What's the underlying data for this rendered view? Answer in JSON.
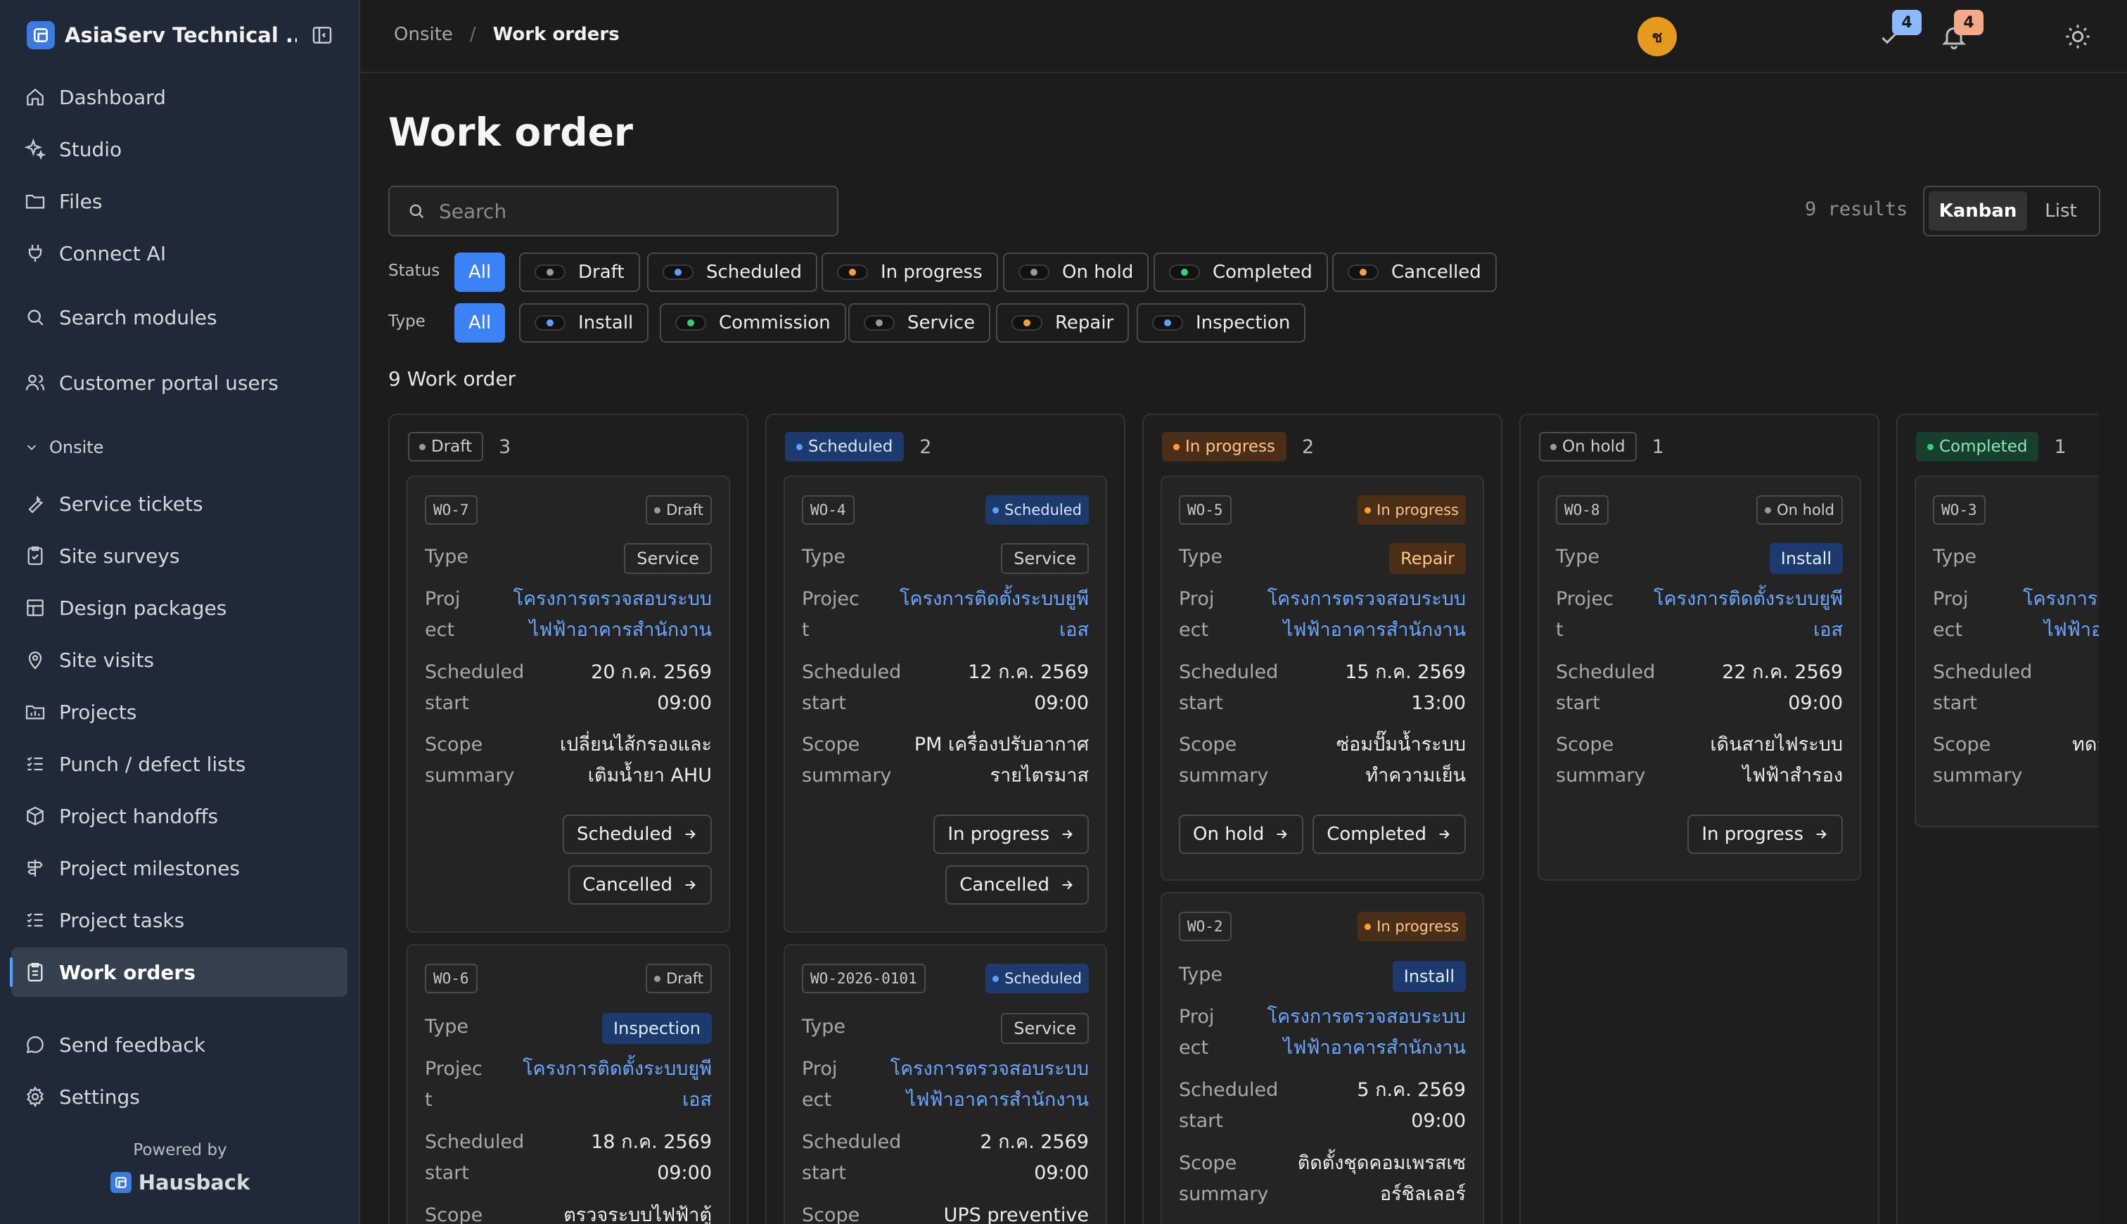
{
  "app": {
    "name": "AsiaServ Technical ...",
    "powered_by": "Powered by",
    "powered_brand": "Hausback"
  },
  "sidebar": {
    "items": [
      {
        "label": "Dashboard"
      },
      {
        "label": "Studio"
      },
      {
        "label": "Files"
      },
      {
        "label": "Connect AI"
      },
      {
        "label": "Search modules"
      },
      {
        "label": "Customer portal users"
      }
    ],
    "section": "Onsite",
    "onsite_items": [
      {
        "label": "Service tickets"
      },
      {
        "label": "Site surveys"
      },
      {
        "label": "Design packages"
      },
      {
        "label": "Site visits"
      },
      {
        "label": "Projects"
      },
      {
        "label": "Punch / defect lists"
      },
      {
        "label": "Project handoffs"
      },
      {
        "label": "Project milestones"
      },
      {
        "label": "Project tasks"
      },
      {
        "label": "Work orders"
      }
    ],
    "footer_items": [
      {
        "label": "Send feedback"
      },
      {
        "label": "Settings"
      }
    ]
  },
  "topbar": {
    "breadcrumb": [
      "Onsite",
      "Work orders"
    ],
    "tasks_badge": "4",
    "notifications_badge": "4",
    "avatar_initial": "ช"
  },
  "page": {
    "title": "Work order",
    "search_placeholder": "Search",
    "results": "9 results",
    "views": [
      "Kanban",
      "List"
    ],
    "count_line": "9 Work order"
  },
  "filters": {
    "status_label": "Status",
    "status": [
      "All",
      "Draft",
      "Scheduled",
      "In progress",
      "On hold",
      "Completed",
      "Cancelled"
    ],
    "type_label": "Type",
    "type": [
      "All",
      "Install",
      "Commission",
      "Service",
      "Repair",
      "Inspection"
    ]
  },
  "colors": {
    "accent": "#3b82f6",
    "draft": "#9a9a9a",
    "scheduled": "#5aa0ff",
    "in_progress": "#ff9d3b",
    "on_hold": "#9a9a9a",
    "completed": "#35d07f",
    "cancelled": "#ff9d3b"
  },
  "labels": {
    "type": "Type",
    "project_a": "Proj",
    "project_b": "ect",
    "project_c": "Projec",
    "project_d": "t",
    "sched_a": "Scheduled",
    "sched_b": "start",
    "scope_a": "Scope",
    "scope_b": "summary"
  },
  "columns": [
    {
      "status": "Draft",
      "count": "3",
      "cards": [
        {
          "id": "WO-7",
          "status": "Draft",
          "type": "Service",
          "project_1": "โครงการตรวจสอบระบบ",
          "project_2": "ไฟฟ้าอาคารสำนักงาน",
          "date": "20 ก.ค. 2569",
          "time": "09:00",
          "scope_1": "เปลี่ยนไส้กรองและ",
          "scope_2": "เติมน้ำยา AHU",
          "actions": [
            "Scheduled",
            "Cancelled"
          ]
        },
        {
          "id": "WO-6",
          "status": "Draft",
          "type": "Inspection",
          "project_1": "โครงการติดตั้งระบบยูพี",
          "project_2": "เอส",
          "date": "18 ก.ค. 2569",
          "time": "09:00",
          "scope_1": "ตรวจระบบไฟฟ้าตู้"
        }
      ]
    },
    {
      "status": "Scheduled",
      "count": "2",
      "cards": [
        {
          "id": "WO-4",
          "status": "Scheduled",
          "type": "Service",
          "project_1": "โครงการติดตั้งระบบยูพี",
          "project_2": "เอส",
          "date": "12 ก.ค. 2569",
          "time": "09:00",
          "scope_1": "PM เครื่องปรับอากาศ",
          "scope_2": "รายไตรมาส",
          "actions": [
            "In progress",
            "Cancelled"
          ]
        },
        {
          "id": "WO-2026-0101",
          "status": "Scheduled",
          "type": "Service",
          "project_1": "โครงการตรวจสอบระบบ",
          "project_2": "ไฟฟ้าอาคารสำนักงาน",
          "date": "2 ก.ค. 2569",
          "time": "09:00",
          "scope_1": "UPS preventive"
        }
      ]
    },
    {
      "status": "In progress",
      "count": "2",
      "cards": [
        {
          "id": "WO-5",
          "status": "In progress",
          "type": "Repair",
          "project_1": "โครงการตรวจสอบระบบ",
          "project_2": "ไฟฟ้าอาคารสำนักงาน",
          "date": "15 ก.ค. 2569",
          "time": "13:00",
          "scope_1": "ซ่อมปั๊มน้ำระบบ",
          "scope_2": "ทำความเย็น",
          "actions": [
            "On hold",
            "Completed"
          ]
        },
        {
          "id": "WO-2",
          "status": "In progress",
          "type": "Install",
          "project_1": "โครงการตรวจสอบระบบ",
          "project_2": "ไฟฟ้าอาคารสำนักงาน",
          "date": "5 ก.ค. 2569",
          "time": "09:00",
          "scope_1": "ติดตั้งชุดคอมเพรสเซ",
          "scope_2": "อร์ชิลเลอร์"
        }
      ]
    },
    {
      "status": "On hold",
      "count": "1",
      "cards": [
        {
          "id": "WO-8",
          "status": "On hold",
          "type": "Install",
          "project_1": "โครงการติดตั้งระบบยูพี",
          "project_2": "เอส",
          "date": "22 ก.ค. 2569",
          "time": "09:00",
          "scope_1": "เดินสายไฟระบบ",
          "scope_2": "ไฟฟ้าสำรอง",
          "actions": [
            "In progress"
          ]
        }
      ]
    },
    {
      "status": "Completed",
      "count": "1",
      "cards": [
        {
          "id": "WO-3",
          "project_1": "โครงการต",
          "project_2": "ไฟฟ้าอ",
          "scope_1": "ทดส"
        }
      ]
    }
  ]
}
